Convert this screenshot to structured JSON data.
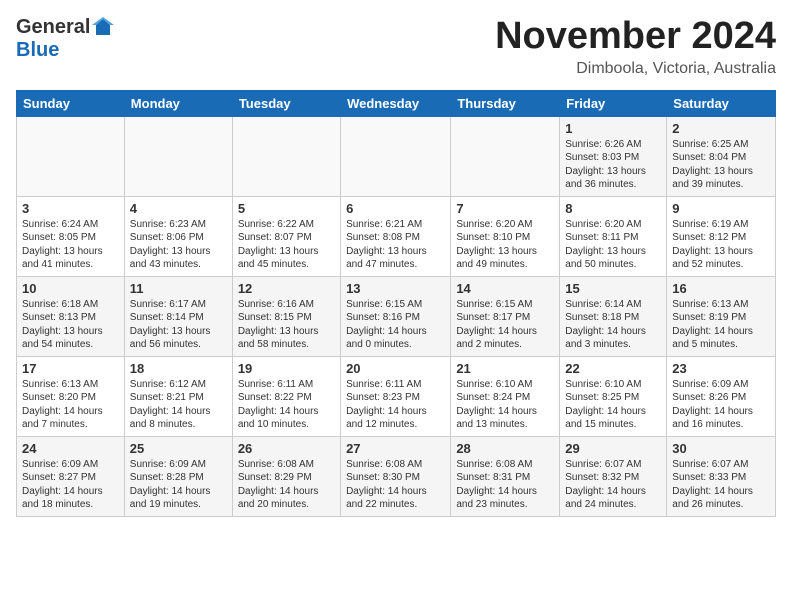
{
  "logo": {
    "general": "General",
    "blue": "Blue"
  },
  "header": {
    "month": "November 2024",
    "location": "Dimboola, Victoria, Australia"
  },
  "weekdays": [
    "Sunday",
    "Monday",
    "Tuesday",
    "Wednesday",
    "Thursday",
    "Friday",
    "Saturday"
  ],
  "weeks": [
    [
      {
        "day": "",
        "info": ""
      },
      {
        "day": "",
        "info": ""
      },
      {
        "day": "",
        "info": ""
      },
      {
        "day": "",
        "info": ""
      },
      {
        "day": "",
        "info": ""
      },
      {
        "day": "1",
        "info": "Sunrise: 6:26 AM\nSunset: 8:03 PM\nDaylight: 13 hours\nand 36 minutes."
      },
      {
        "day": "2",
        "info": "Sunrise: 6:25 AM\nSunset: 8:04 PM\nDaylight: 13 hours\nand 39 minutes."
      }
    ],
    [
      {
        "day": "3",
        "info": "Sunrise: 6:24 AM\nSunset: 8:05 PM\nDaylight: 13 hours\nand 41 minutes."
      },
      {
        "day": "4",
        "info": "Sunrise: 6:23 AM\nSunset: 8:06 PM\nDaylight: 13 hours\nand 43 minutes."
      },
      {
        "day": "5",
        "info": "Sunrise: 6:22 AM\nSunset: 8:07 PM\nDaylight: 13 hours\nand 45 minutes."
      },
      {
        "day": "6",
        "info": "Sunrise: 6:21 AM\nSunset: 8:08 PM\nDaylight: 13 hours\nand 47 minutes."
      },
      {
        "day": "7",
        "info": "Sunrise: 6:20 AM\nSunset: 8:10 PM\nDaylight: 13 hours\nand 49 minutes."
      },
      {
        "day": "8",
        "info": "Sunrise: 6:20 AM\nSunset: 8:11 PM\nDaylight: 13 hours\nand 50 minutes."
      },
      {
        "day": "9",
        "info": "Sunrise: 6:19 AM\nSunset: 8:12 PM\nDaylight: 13 hours\nand 52 minutes."
      }
    ],
    [
      {
        "day": "10",
        "info": "Sunrise: 6:18 AM\nSunset: 8:13 PM\nDaylight: 13 hours\nand 54 minutes."
      },
      {
        "day": "11",
        "info": "Sunrise: 6:17 AM\nSunset: 8:14 PM\nDaylight: 13 hours\nand 56 minutes."
      },
      {
        "day": "12",
        "info": "Sunrise: 6:16 AM\nSunset: 8:15 PM\nDaylight: 13 hours\nand 58 minutes."
      },
      {
        "day": "13",
        "info": "Sunrise: 6:15 AM\nSunset: 8:16 PM\nDaylight: 14 hours\nand 0 minutes."
      },
      {
        "day": "14",
        "info": "Sunrise: 6:15 AM\nSunset: 8:17 PM\nDaylight: 14 hours\nand 2 minutes."
      },
      {
        "day": "15",
        "info": "Sunrise: 6:14 AM\nSunset: 8:18 PM\nDaylight: 14 hours\nand 3 minutes."
      },
      {
        "day": "16",
        "info": "Sunrise: 6:13 AM\nSunset: 8:19 PM\nDaylight: 14 hours\nand 5 minutes."
      }
    ],
    [
      {
        "day": "17",
        "info": "Sunrise: 6:13 AM\nSunset: 8:20 PM\nDaylight: 14 hours\nand 7 minutes."
      },
      {
        "day": "18",
        "info": "Sunrise: 6:12 AM\nSunset: 8:21 PM\nDaylight: 14 hours\nand 8 minutes."
      },
      {
        "day": "19",
        "info": "Sunrise: 6:11 AM\nSunset: 8:22 PM\nDaylight: 14 hours\nand 10 minutes."
      },
      {
        "day": "20",
        "info": "Sunrise: 6:11 AM\nSunset: 8:23 PM\nDaylight: 14 hours\nand 12 minutes."
      },
      {
        "day": "21",
        "info": "Sunrise: 6:10 AM\nSunset: 8:24 PM\nDaylight: 14 hours\nand 13 minutes."
      },
      {
        "day": "22",
        "info": "Sunrise: 6:10 AM\nSunset: 8:25 PM\nDaylight: 14 hours\nand 15 minutes."
      },
      {
        "day": "23",
        "info": "Sunrise: 6:09 AM\nSunset: 8:26 PM\nDaylight: 14 hours\nand 16 minutes."
      }
    ],
    [
      {
        "day": "24",
        "info": "Sunrise: 6:09 AM\nSunset: 8:27 PM\nDaylight: 14 hours\nand 18 minutes."
      },
      {
        "day": "25",
        "info": "Sunrise: 6:09 AM\nSunset: 8:28 PM\nDaylight: 14 hours\nand 19 minutes."
      },
      {
        "day": "26",
        "info": "Sunrise: 6:08 AM\nSunset: 8:29 PM\nDaylight: 14 hours\nand 20 minutes."
      },
      {
        "day": "27",
        "info": "Sunrise: 6:08 AM\nSunset: 8:30 PM\nDaylight: 14 hours\nand 22 minutes."
      },
      {
        "day": "28",
        "info": "Sunrise: 6:08 AM\nSunset: 8:31 PM\nDaylight: 14 hours\nand 23 minutes."
      },
      {
        "day": "29",
        "info": "Sunrise: 6:07 AM\nSunset: 8:32 PM\nDaylight: 14 hours\nand 24 minutes."
      },
      {
        "day": "30",
        "info": "Sunrise: 6:07 AM\nSunset: 8:33 PM\nDaylight: 14 hours\nand 26 minutes."
      }
    ]
  ]
}
